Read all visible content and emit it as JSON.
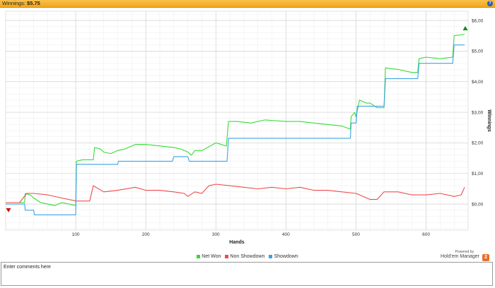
{
  "header": {
    "label": "Winnings:",
    "value": "$5.75",
    "help_icon": "help-icon"
  },
  "comments": {
    "placeholder": "Enter comments here"
  },
  "powered": {
    "line1": "Powered by",
    "brand": "Hold'em Manager",
    "logo": "2"
  },
  "chart_data": {
    "type": "line",
    "xlabel": "Hands",
    "ylabel": "Winnings",
    "xlim": [
      0,
      660
    ],
    "ylim": [
      -0.85,
      6.3
    ],
    "x_ticks": [
      100,
      200,
      300,
      400,
      500,
      600
    ],
    "y_ticks": [
      0,
      1,
      2,
      3,
      4,
      5,
      6
    ],
    "y_tick_labels": [
      "$0,00",
      "$1,00",
      "$2,00",
      "$3,00",
      "$4,00",
      "$5,00",
      "$6,00"
    ],
    "grid": true,
    "legend_position": "bottom",
    "markers": {
      "start_value": -0.2,
      "end_value": 5.75
    },
    "series": [
      {
        "name": "Net Won",
        "color": "#33dd33",
        "points": [
          [
            0,
            0.05
          ],
          [
            10,
            0.05
          ],
          [
            20,
            0.05
          ],
          [
            27,
            0.05
          ],
          [
            28,
            0.35
          ],
          [
            35,
            0.3
          ],
          [
            40,
            0.2
          ],
          [
            50,
            0.05
          ],
          [
            60,
            0.0
          ],
          [
            70,
            -0.05
          ],
          [
            80,
            0.05
          ],
          [
            90,
            0.0
          ],
          [
            100,
            -0.05
          ],
          [
            101,
            1.4
          ],
          [
            110,
            1.45
          ],
          [
            120,
            1.45
          ],
          [
            125,
            1.45
          ],
          [
            127,
            1.85
          ],
          [
            135,
            1.8
          ],
          [
            140,
            1.7
          ],
          [
            150,
            1.65
          ],
          [
            160,
            1.75
          ],
          [
            170,
            1.8
          ],
          [
            185,
            1.95
          ],
          [
            200,
            1.95
          ],
          [
            220,
            1.9
          ],
          [
            240,
            1.85
          ],
          [
            250,
            1.8
          ],
          [
            260,
            1.7
          ],
          [
            265,
            1.6
          ],
          [
            270,
            1.75
          ],
          [
            280,
            1.75
          ],
          [
            300,
            2.0
          ],
          [
            315,
            1.9
          ],
          [
            318,
            2.7
          ],
          [
            330,
            2.7
          ],
          [
            350,
            2.65
          ],
          [
            370,
            2.75
          ],
          [
            400,
            2.7
          ],
          [
            420,
            2.7
          ],
          [
            440,
            2.65
          ],
          [
            460,
            2.6
          ],
          [
            480,
            2.55
          ],
          [
            492,
            2.45
          ],
          [
            493,
            2.85
          ],
          [
            498,
            3.0
          ],
          [
            500,
            2.85
          ],
          [
            505,
            3.4
          ],
          [
            515,
            3.3
          ],
          [
            520,
            3.3
          ],
          [
            530,
            3.15
          ],
          [
            540,
            3.15
          ],
          [
            542,
            4.45
          ],
          [
            560,
            4.4
          ],
          [
            580,
            4.3
          ],
          [
            588,
            4.3
          ],
          [
            590,
            4.75
          ],
          [
            600,
            4.8
          ],
          [
            620,
            4.75
          ],
          [
            638,
            4.8
          ],
          [
            640,
            5.5
          ],
          [
            655,
            5.55
          ]
        ]
      },
      {
        "name": "Non Showdown",
        "color": "#ee4c4c",
        "points": [
          [
            0,
            0.05
          ],
          [
            20,
            0.05
          ],
          [
            30,
            0.35
          ],
          [
            40,
            0.35
          ],
          [
            60,
            0.3
          ],
          [
            80,
            0.2
          ],
          [
            101,
            0.1
          ],
          [
            120,
            0.1
          ],
          [
            125,
            0.6
          ],
          [
            140,
            0.4
          ],
          [
            160,
            0.45
          ],
          [
            185,
            0.55
          ],
          [
            200,
            0.45
          ],
          [
            220,
            0.45
          ],
          [
            240,
            0.4
          ],
          [
            255,
            0.35
          ],
          [
            260,
            0.25
          ],
          [
            270,
            0.4
          ],
          [
            280,
            0.35
          ],
          [
            290,
            0.6
          ],
          [
            300,
            0.65
          ],
          [
            320,
            0.6
          ],
          [
            340,
            0.55
          ],
          [
            360,
            0.5
          ],
          [
            380,
            0.55
          ],
          [
            400,
            0.5
          ],
          [
            420,
            0.55
          ],
          [
            440,
            0.45
          ],
          [
            460,
            0.45
          ],
          [
            480,
            0.4
          ],
          [
            500,
            0.35
          ],
          [
            510,
            0.25
          ],
          [
            520,
            0.15
          ],
          [
            530,
            0.15
          ],
          [
            540,
            0.4
          ],
          [
            560,
            0.4
          ],
          [
            580,
            0.3
          ],
          [
            600,
            0.3
          ],
          [
            620,
            0.35
          ],
          [
            640,
            0.25
          ],
          [
            650,
            0.3
          ],
          [
            655,
            0.55
          ]
        ]
      },
      {
        "name": "Showdown",
        "color": "#3aa2e8",
        "points": [
          [
            0,
            0.0
          ],
          [
            27,
            0.0
          ],
          [
            28,
            -0.2
          ],
          [
            40,
            -0.2
          ],
          [
            41,
            -0.35
          ],
          [
            100,
            -0.35
          ],
          [
            101,
            1.3
          ],
          [
            160,
            1.3
          ],
          [
            161,
            1.4
          ],
          [
            238,
            1.4
          ],
          [
            240,
            1.55
          ],
          [
            260,
            1.55
          ],
          [
            262,
            1.4
          ],
          [
            316,
            1.4
          ],
          [
            318,
            2.15
          ],
          [
            492,
            2.15
          ],
          [
            493,
            2.65
          ],
          [
            500,
            2.65
          ],
          [
            502,
            3.2
          ],
          [
            540,
            3.2
          ],
          [
            542,
            4.1
          ],
          [
            588,
            4.1
          ],
          [
            590,
            4.6
          ],
          [
            638,
            4.6
          ],
          [
            640,
            5.2
          ],
          [
            655,
            5.2
          ]
        ]
      }
    ]
  }
}
